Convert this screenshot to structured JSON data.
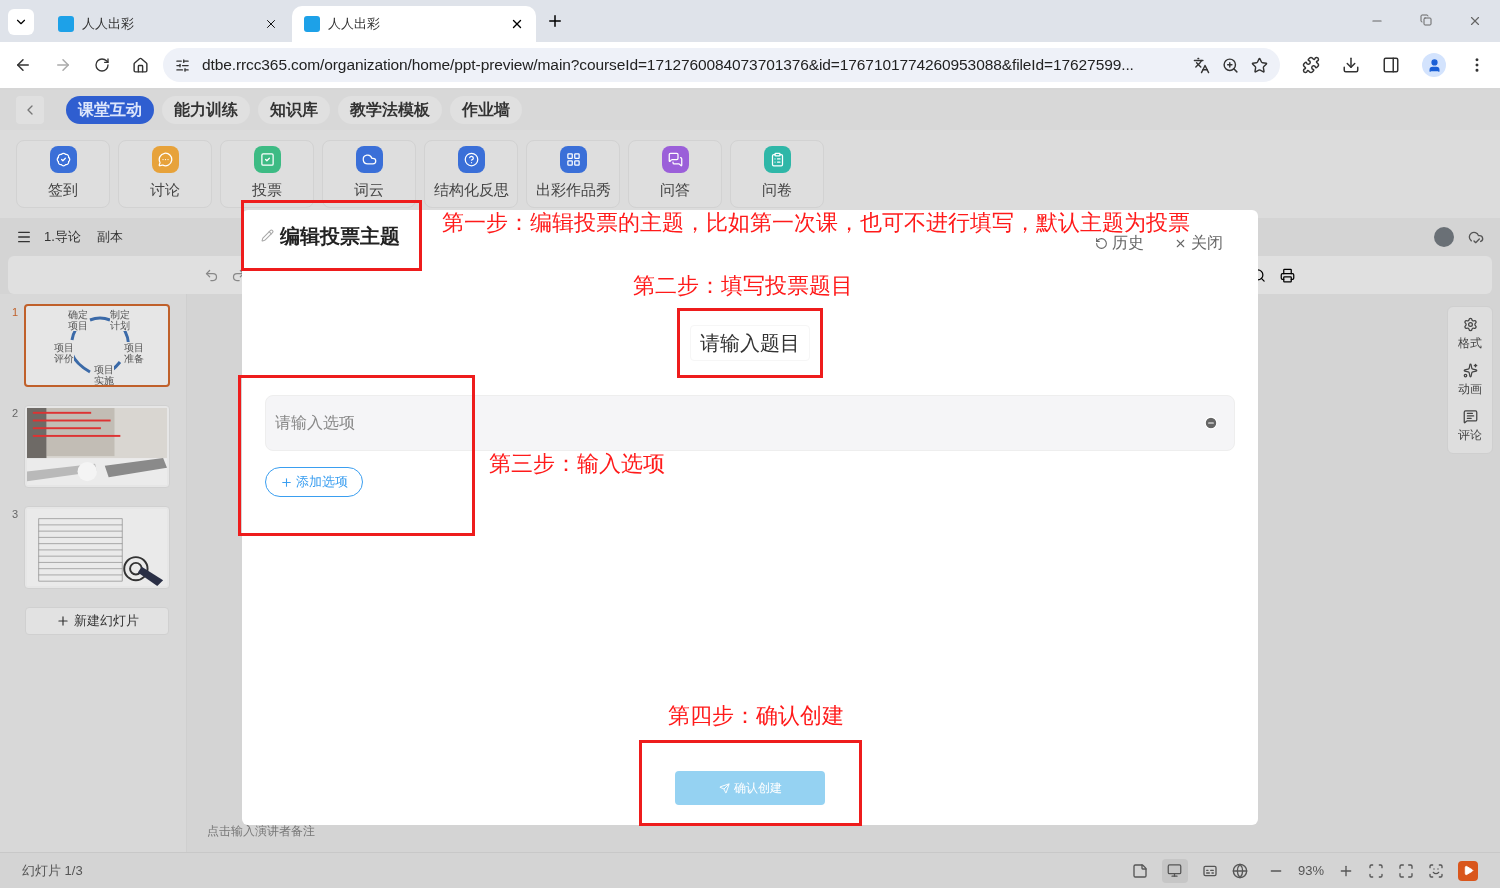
{
  "browser": {
    "tabs": [
      {
        "title": "人人出彩",
        "selected": false
      },
      {
        "title": "人人出彩",
        "selected": true
      }
    ],
    "url": "dtbe.rrcc365.com/organization/home/ppt-preview/main?courseId=1712760084073701376&id=1767101774260953088&fileId=17627599..."
  },
  "nav_tabs": [
    {
      "label": "课堂互动",
      "selected": true
    },
    {
      "label": "能力训练",
      "selected": false
    },
    {
      "label": "知识库",
      "selected": false
    },
    {
      "label": "教学法模板",
      "selected": false
    },
    {
      "label": "作业墙",
      "selected": false
    }
  ],
  "tools": [
    {
      "label": "签到",
      "color": "#3a6fd8"
    },
    {
      "label": "讨论",
      "color": "#e7a23a"
    },
    {
      "label": "投票",
      "color": "#3dbb84"
    },
    {
      "label": "词云",
      "color": "#3a6fd8"
    },
    {
      "label": "结构化反思",
      "color": "#3a6fd8"
    },
    {
      "label": "出彩作品秀",
      "color": "#3a6fd8"
    },
    {
      "label": "问答",
      "color": "#9b5fd9"
    },
    {
      "label": "问卷",
      "color": "#2fb7a8"
    }
  ],
  "editor": {
    "menu_items": [
      "1.导论",
      "副本"
    ]
  },
  "slides": [
    {
      "number": "1",
      "selected": true,
      "kind": "cycle",
      "labels": [
        "确定项目",
        "制定计划",
        "项目准备",
        "项目实施",
        "项目评价"
      ]
    },
    {
      "number": "2",
      "selected": false,
      "kind": "picture"
    },
    {
      "number": "3",
      "selected": false,
      "kind": "table"
    }
  ],
  "new_slide_button": "新建幻灯片",
  "side_panel": [
    "格式",
    "动画",
    "评论"
  ],
  "notes_placeholder": "点击输入演讲者备注",
  "status_bar": {
    "slide_count": "幻灯片 1/3",
    "zoom": "93%"
  },
  "dialog": {
    "title": "编辑投票主题",
    "actions": [
      "历史",
      "关闭"
    ],
    "question_placeholder": "请输入题目",
    "options": [
      {
        "placeholder": "请输入选项"
      }
    ],
    "add_option": "添加选项",
    "confirm": "确认创建",
    "confirm_disabled": true
  },
  "annotations": [
    "第一步：编辑投票的主题，比如第一次课，也可不进行填写，默认主题为投票",
    "第二步：填写投票题目",
    "第三步：输入选项",
    "第四步：确认创建"
  ]
}
